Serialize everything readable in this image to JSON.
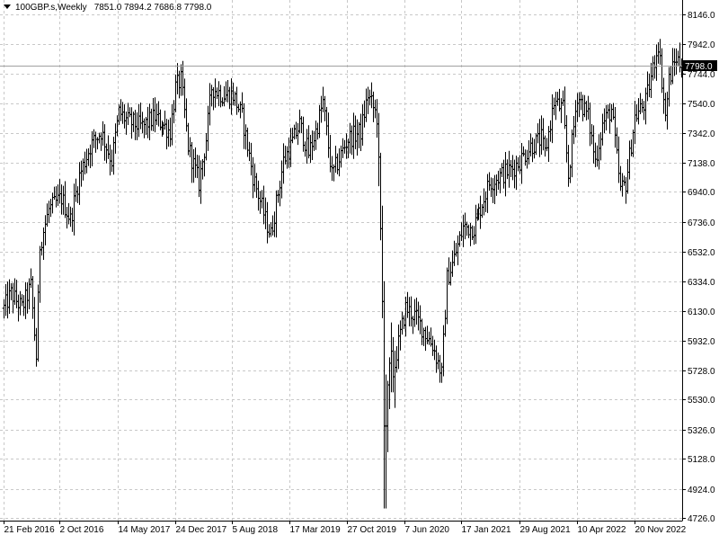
{
  "header": {
    "symbol": "100GBP.s,Weekly",
    "ohlc": "7851.0 7894.2 7686.8 7798.0"
  },
  "chart_data": {
    "type": "ohlc",
    "timeframe": "Weekly",
    "ylim": [
      4726.0,
      8146.0
    ],
    "grid": true,
    "current_price": 7798.0,
    "current_price_label": "7798.0",
    "y_ticks": [
      "8146.0",
      "7942.0",
      "7744.0",
      "7540.0",
      "7342.0",
      "7138.0",
      "6940.0",
      "6736.0",
      "6532.0",
      "6334.0",
      "6130.0",
      "5932.0",
      "5728.0",
      "5530.0",
      "5326.0",
      "5128.0",
      "4924.0",
      "4726.0"
    ],
    "x_ticks": [
      "21 Feb 2016",
      "2 Oct 2016",
      "14 May 2017",
      "24 Dec 2017",
      "5 Aug 2018",
      "17 Mar 2019",
      "27 Oct 2019",
      "7 Jun 2020",
      "17 Jan 2021",
      "29 Aug 2021",
      "10 Apr 2022",
      "20 Nov 2022"
    ],
    "anchors": [
      [
        "2016-02-21",
        6150
      ],
      [
        "2016-03-20",
        6250
      ],
      [
        "2016-05-01",
        6150
      ],
      [
        "2016-06-05",
        6300
      ],
      [
        "2016-06-26",
        5820
      ],
      [
        "2016-07-10",
        6580
      ],
      [
        "2016-08-14",
        6820
      ],
      [
        "2016-10-02",
        6900
      ],
      [
        "2016-11-06",
        6750
      ],
      [
        "2016-12-11",
        7050
      ],
      [
        "2017-01-22",
        7250
      ],
      [
        "2017-03-05",
        7350
      ],
      [
        "2017-04-16",
        7150
      ],
      [
        "2017-05-14",
        7480
      ],
      [
        "2017-06-18",
        7420
      ],
      [
        "2017-08-13",
        7380
      ],
      [
        "2017-10-01",
        7450
      ],
      [
        "2017-12-03",
        7350
      ],
      [
        "2017-12-24",
        7650
      ],
      [
        "2018-01-14",
        7700
      ],
      [
        "2018-02-11",
        7250
      ],
      [
        "2018-03-25",
        7000
      ],
      [
        "2018-04-22",
        7300
      ],
      [
        "2018-05-13",
        7650
      ],
      [
        "2018-06-24",
        7600
      ],
      [
        "2018-08-05",
        7600
      ],
      [
        "2018-09-09",
        7450
      ],
      [
        "2018-10-21",
        7050
      ],
      [
        "2018-12-09",
        6750
      ],
      [
        "2018-12-30",
        6650
      ],
      [
        "2019-02-17",
        7150
      ],
      [
        "2019-03-17",
        7250
      ],
      [
        "2019-04-21",
        7400
      ],
      [
        "2019-05-26",
        7200
      ],
      [
        "2019-06-23",
        7350
      ],
      [
        "2019-07-21",
        7550
      ],
      [
        "2019-08-25",
        7050
      ],
      [
        "2019-10-13",
        7250
      ],
      [
        "2019-10-27",
        7300
      ],
      [
        "2019-12-15",
        7350
      ],
      [
        "2020-01-12",
        7600
      ],
      [
        "2020-02-16",
        7450
      ],
      [
        "2020-03-01",
        6600
      ],
      [
        "2020-03-22",
        5300
      ],
      [
        "2020-04-05",
        5650
      ],
      [
        "2020-05-03",
        5850
      ],
      [
        "2020-06-07",
        6150
      ],
      [
        "2020-07-12",
        6100
      ],
      [
        "2020-08-16",
        6000
      ],
      [
        "2020-09-20",
        5900
      ],
      [
        "2020-10-25",
        5700
      ],
      [
        "2020-11-15",
        6350
      ],
      [
        "2020-12-06",
        6450
      ],
      [
        "2021-01-17",
        6700
      ],
      [
        "2021-02-28",
        6700
      ],
      [
        "2021-03-21",
        6800
      ],
      [
        "2021-05-02",
        7000
      ],
      [
        "2021-06-13",
        7050
      ],
      [
        "2021-08-01",
        7100
      ],
      [
        "2021-08-29",
        7150
      ],
      [
        "2021-10-10",
        7250
      ],
      [
        "2021-11-21",
        7300
      ],
      [
        "2021-12-05",
        7200
      ],
      [
        "2022-01-09",
        7550
      ],
      [
        "2022-02-13",
        7500
      ],
      [
        "2022-03-06",
        7050
      ],
      [
        "2022-04-10",
        7600
      ],
      [
        "2022-05-22",
        7450
      ],
      [
        "2022-06-19",
        7150
      ],
      [
        "2022-07-17",
        7400
      ],
      [
        "2022-08-21",
        7500
      ],
      [
        "2022-09-25",
        6950
      ],
      [
        "2022-10-16",
        7000
      ],
      [
        "2022-11-20",
        7450
      ],
      [
        "2023-01-01",
        7550
      ],
      [
        "2023-02-19",
        7950
      ],
      [
        "2023-03-19",
        7450
      ],
      [
        "2023-04-02",
        7700
      ],
      [
        "2023-04-30",
        7850
      ],
      [
        "2023-05-21",
        7800
      ]
    ]
  }
}
